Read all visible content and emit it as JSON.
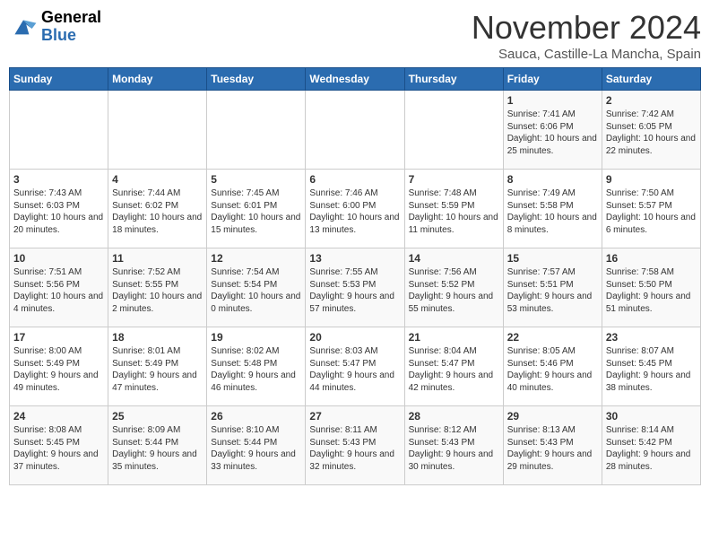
{
  "header": {
    "logo_line1": "General",
    "logo_line2": "Blue",
    "month": "November 2024",
    "location": "Sauca, Castille-La Mancha, Spain"
  },
  "weekdays": [
    "Sunday",
    "Monday",
    "Tuesday",
    "Wednesday",
    "Thursday",
    "Friday",
    "Saturday"
  ],
  "weeks": [
    [
      {
        "day": "",
        "info": ""
      },
      {
        "day": "",
        "info": ""
      },
      {
        "day": "",
        "info": ""
      },
      {
        "day": "",
        "info": ""
      },
      {
        "day": "",
        "info": ""
      },
      {
        "day": "1",
        "info": "Sunrise: 7:41 AM\nSunset: 6:06 PM\nDaylight: 10 hours and 25 minutes."
      },
      {
        "day": "2",
        "info": "Sunrise: 7:42 AM\nSunset: 6:05 PM\nDaylight: 10 hours and 22 minutes."
      }
    ],
    [
      {
        "day": "3",
        "info": "Sunrise: 7:43 AM\nSunset: 6:03 PM\nDaylight: 10 hours and 20 minutes."
      },
      {
        "day": "4",
        "info": "Sunrise: 7:44 AM\nSunset: 6:02 PM\nDaylight: 10 hours and 18 minutes."
      },
      {
        "day": "5",
        "info": "Sunrise: 7:45 AM\nSunset: 6:01 PM\nDaylight: 10 hours and 15 minutes."
      },
      {
        "day": "6",
        "info": "Sunrise: 7:46 AM\nSunset: 6:00 PM\nDaylight: 10 hours and 13 minutes."
      },
      {
        "day": "7",
        "info": "Sunrise: 7:48 AM\nSunset: 5:59 PM\nDaylight: 10 hours and 11 minutes."
      },
      {
        "day": "8",
        "info": "Sunrise: 7:49 AM\nSunset: 5:58 PM\nDaylight: 10 hours and 8 minutes."
      },
      {
        "day": "9",
        "info": "Sunrise: 7:50 AM\nSunset: 5:57 PM\nDaylight: 10 hours and 6 minutes."
      }
    ],
    [
      {
        "day": "10",
        "info": "Sunrise: 7:51 AM\nSunset: 5:56 PM\nDaylight: 10 hours and 4 minutes."
      },
      {
        "day": "11",
        "info": "Sunrise: 7:52 AM\nSunset: 5:55 PM\nDaylight: 10 hours and 2 minutes."
      },
      {
        "day": "12",
        "info": "Sunrise: 7:54 AM\nSunset: 5:54 PM\nDaylight: 10 hours and 0 minutes."
      },
      {
        "day": "13",
        "info": "Sunrise: 7:55 AM\nSunset: 5:53 PM\nDaylight: 9 hours and 57 minutes."
      },
      {
        "day": "14",
        "info": "Sunrise: 7:56 AM\nSunset: 5:52 PM\nDaylight: 9 hours and 55 minutes."
      },
      {
        "day": "15",
        "info": "Sunrise: 7:57 AM\nSunset: 5:51 PM\nDaylight: 9 hours and 53 minutes."
      },
      {
        "day": "16",
        "info": "Sunrise: 7:58 AM\nSunset: 5:50 PM\nDaylight: 9 hours and 51 minutes."
      }
    ],
    [
      {
        "day": "17",
        "info": "Sunrise: 8:00 AM\nSunset: 5:49 PM\nDaylight: 9 hours and 49 minutes."
      },
      {
        "day": "18",
        "info": "Sunrise: 8:01 AM\nSunset: 5:49 PM\nDaylight: 9 hours and 47 minutes."
      },
      {
        "day": "19",
        "info": "Sunrise: 8:02 AM\nSunset: 5:48 PM\nDaylight: 9 hours and 46 minutes."
      },
      {
        "day": "20",
        "info": "Sunrise: 8:03 AM\nSunset: 5:47 PM\nDaylight: 9 hours and 44 minutes."
      },
      {
        "day": "21",
        "info": "Sunrise: 8:04 AM\nSunset: 5:47 PM\nDaylight: 9 hours and 42 minutes."
      },
      {
        "day": "22",
        "info": "Sunrise: 8:05 AM\nSunset: 5:46 PM\nDaylight: 9 hours and 40 minutes."
      },
      {
        "day": "23",
        "info": "Sunrise: 8:07 AM\nSunset: 5:45 PM\nDaylight: 9 hours and 38 minutes."
      }
    ],
    [
      {
        "day": "24",
        "info": "Sunrise: 8:08 AM\nSunset: 5:45 PM\nDaylight: 9 hours and 37 minutes."
      },
      {
        "day": "25",
        "info": "Sunrise: 8:09 AM\nSunset: 5:44 PM\nDaylight: 9 hours and 35 minutes."
      },
      {
        "day": "26",
        "info": "Sunrise: 8:10 AM\nSunset: 5:44 PM\nDaylight: 9 hours and 33 minutes."
      },
      {
        "day": "27",
        "info": "Sunrise: 8:11 AM\nSunset: 5:43 PM\nDaylight: 9 hours and 32 minutes."
      },
      {
        "day": "28",
        "info": "Sunrise: 8:12 AM\nSunset: 5:43 PM\nDaylight: 9 hours and 30 minutes."
      },
      {
        "day": "29",
        "info": "Sunrise: 8:13 AM\nSunset: 5:43 PM\nDaylight: 9 hours and 29 minutes."
      },
      {
        "day": "30",
        "info": "Sunrise: 8:14 AM\nSunset: 5:42 PM\nDaylight: 9 hours and 28 minutes."
      }
    ]
  ]
}
